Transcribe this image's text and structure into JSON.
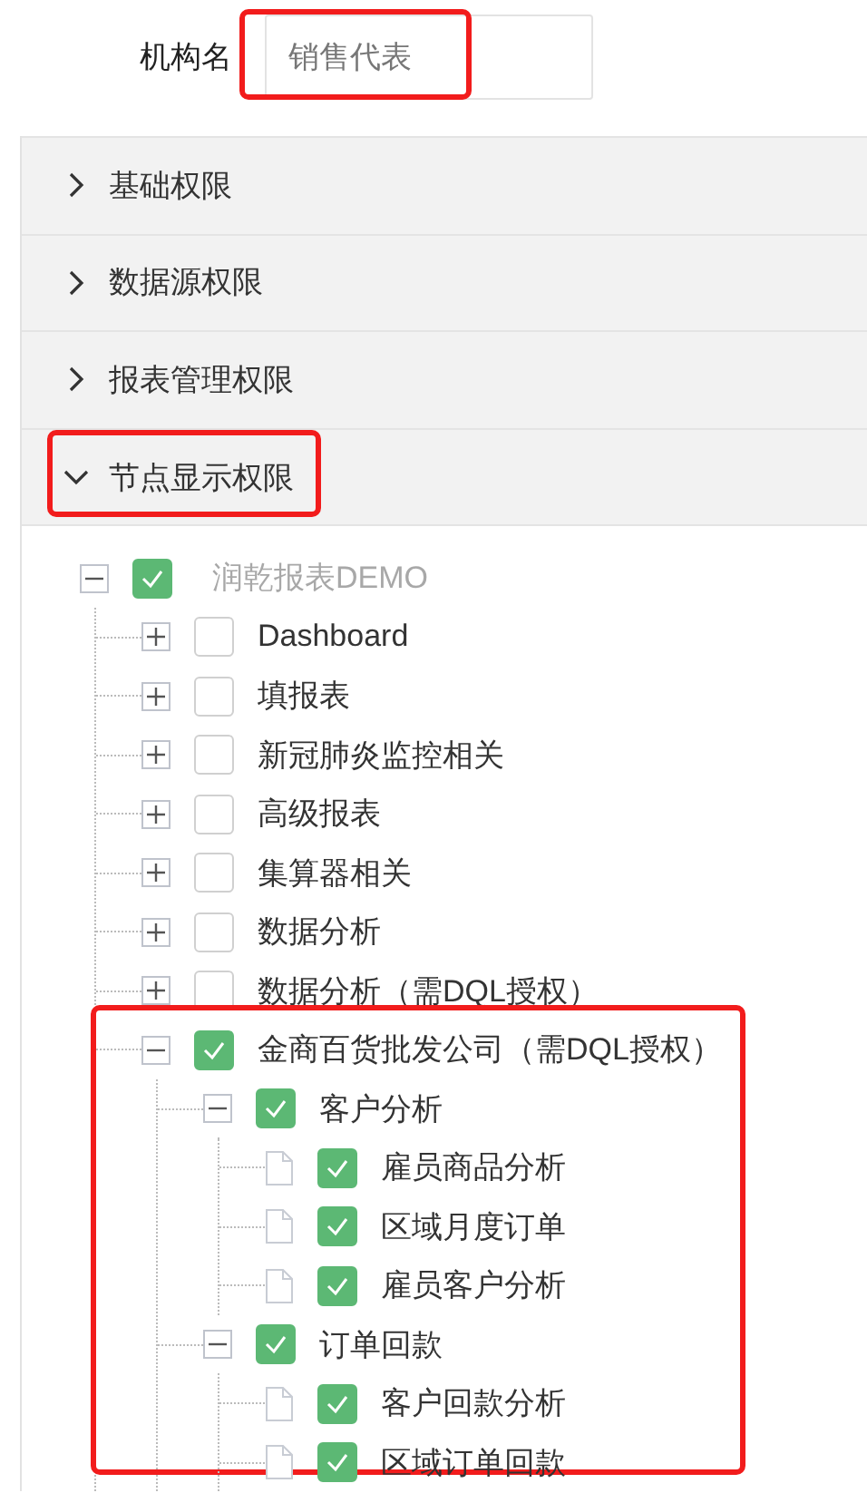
{
  "org_name": {
    "label": "机构名",
    "value": "销售代表",
    "highlighted": true
  },
  "panels": [
    {
      "title": "基础权限",
      "expanded": false,
      "highlighted": false
    },
    {
      "title": "数据源权限",
      "expanded": false,
      "highlighted": false
    },
    {
      "title": "报表管理权限",
      "expanded": false,
      "highlighted": false
    },
    {
      "title": "节点显示权限",
      "expanded": true,
      "highlighted": true
    }
  ],
  "tree": {
    "nodes": [
      {
        "label": "润乾报表DEMO",
        "kind": "folder",
        "expanded": true,
        "checked": true,
        "disabled": true,
        "highlighted": false,
        "children": [
          {
            "label": "Dashboard",
            "kind": "folder",
            "expanded": false,
            "checked": false,
            "disabled": false,
            "highlighted": false
          },
          {
            "label": "填报表",
            "kind": "folder",
            "expanded": false,
            "checked": false,
            "disabled": false,
            "highlighted": false
          },
          {
            "label": "新冠肺炎监控相关",
            "kind": "folder",
            "expanded": false,
            "checked": false,
            "disabled": false,
            "highlighted": false
          },
          {
            "label": "高级报表",
            "kind": "folder",
            "expanded": false,
            "checked": false,
            "disabled": false,
            "highlighted": false
          },
          {
            "label": "集算器相关",
            "kind": "folder",
            "expanded": false,
            "checked": false,
            "disabled": false,
            "highlighted": false
          },
          {
            "label": "数据分析",
            "kind": "folder",
            "expanded": false,
            "checked": false,
            "disabled": false,
            "highlighted": false
          },
          {
            "label": "数据分析（需DQL授权）",
            "kind": "folder",
            "expanded": false,
            "checked": false,
            "disabled": false,
            "highlighted": false
          },
          {
            "label": "金商百货批发公司（需DQL授权）",
            "kind": "folder",
            "expanded": true,
            "checked": true,
            "disabled": false,
            "highlighted": true,
            "children": [
              {
                "label": "客户分析",
                "kind": "folder",
                "expanded": true,
                "checked": true,
                "disabled": false,
                "highlighted": false,
                "children": [
                  {
                    "label": "雇员商品分析",
                    "kind": "file",
                    "checked": true,
                    "disabled": false,
                    "highlighted": false
                  },
                  {
                    "label": "区域月度订单",
                    "kind": "file",
                    "checked": true,
                    "disabled": false,
                    "highlighted": false
                  },
                  {
                    "label": "雇员客户分析",
                    "kind": "file",
                    "checked": true,
                    "disabled": false,
                    "highlighted": false
                  }
                ]
              },
              {
                "label": "订单回款",
                "kind": "folder",
                "expanded": true,
                "checked": true,
                "disabled": false,
                "highlighted": false,
                "children": [
                  {
                    "label": "客户回款分析",
                    "kind": "file",
                    "checked": true,
                    "disabled": false,
                    "highlighted": false
                  },
                  {
                    "label": "区域订单回款",
                    "kind": "file",
                    "checked": true,
                    "disabled": false,
                    "highlighted": false
                  }
                ]
              }
            ]
          }
        ]
      }
    ]
  }
}
